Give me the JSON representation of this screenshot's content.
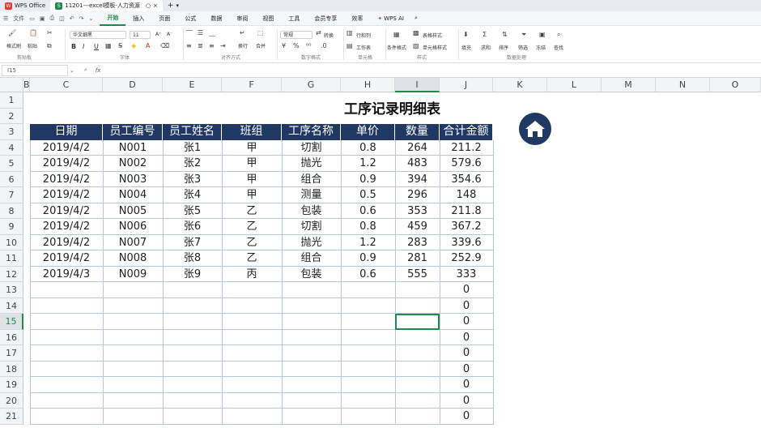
{
  "titlebar": {
    "app_tab": "WPS Office",
    "doc_tab": "11201---excel模板-人力资源",
    "add_tab": "+",
    "dropdown": "▾"
  },
  "menubar": {
    "file": "文件",
    "items": [
      "开始",
      "插入",
      "页面",
      "公式",
      "数据",
      "审阅",
      "视图",
      "工具",
      "会员专享",
      "效率"
    ],
    "active_index": 0,
    "ai": "WPS AI",
    "search_icon": "search-icon"
  },
  "ribbon": {
    "clipboard": {
      "label": "剪贴板",
      "paint": "格式刷",
      "paste": "粘贴",
      "cut_icon": "scissors-icon",
      "copy_icon": "copy-icon"
    },
    "font": {
      "label": "字体",
      "name": "华文细黑",
      "size": "11",
      "bold": "B",
      "italic": "I",
      "underline": "U",
      "grow": "A⁺",
      "shrink": "A⁻"
    },
    "align": {
      "label": "对齐方式",
      "wrap": "换行",
      "merge": "合并"
    },
    "number": {
      "label": "数字格式",
      "format": "常规",
      "convert": "转换"
    },
    "cells": {
      "label": "单元格",
      "rowcol": "行和列",
      "sheet": "工作表"
    },
    "style": {
      "label": "样式",
      "cond": "条件格式",
      "table": "表格样式",
      "cellstyle": "单元格样式"
    },
    "data": {
      "label": "数据处理",
      "fill": "填充",
      "sum": "求和",
      "sort": "排序",
      "filter": "筛选",
      "freeze": "冻结",
      "find": "查找"
    }
  },
  "formulabar": {
    "namebox": "I15",
    "fx": "fx"
  },
  "columns": [
    "B",
    "C",
    "D",
    "E",
    "F",
    "G",
    "H",
    "I",
    "J",
    "K",
    "L",
    "M",
    "N",
    "O"
  ],
  "selected_column": "I",
  "rows": [
    "1",
    "2",
    "3",
    "4",
    "5",
    "6",
    "7",
    "8",
    "9",
    "10",
    "11",
    "12",
    "13",
    "14",
    "15",
    "16",
    "17",
    "18",
    "19",
    "20",
    "21"
  ],
  "selected_row": "15",
  "sheet": {
    "title": "工序记录明细表",
    "headers": [
      "日期",
      "员工编号",
      "员工姓名",
      "班组",
      "工序名称",
      "单价",
      "数量",
      "合计金额"
    ],
    "records": [
      [
        "2019/4/2",
        "N001",
        "张1",
        "甲",
        "切割",
        "0.8",
        "264",
        "211.2"
      ],
      [
        "2019/4/2",
        "N002",
        "张2",
        "甲",
        "抛光",
        "1.2",
        "483",
        "579.6"
      ],
      [
        "2019/4/2",
        "N003",
        "张3",
        "甲",
        "组合",
        "0.9",
        "394",
        "354.6"
      ],
      [
        "2019/4/2",
        "N004",
        "张4",
        "甲",
        "测量",
        "0.5",
        "296",
        "148"
      ],
      [
        "2019/4/2",
        "N005",
        "张5",
        "乙",
        "包装",
        "0.6",
        "353",
        "211.8"
      ],
      [
        "2019/4/2",
        "N006",
        "张6",
        "乙",
        "切割",
        "0.8",
        "459",
        "367.2"
      ],
      [
        "2019/4/2",
        "N007",
        "张7",
        "乙",
        "抛光",
        "1.2",
        "283",
        "339.6"
      ],
      [
        "2019/4/2",
        "N008",
        "张8",
        "乙",
        "组合",
        "0.9",
        "281",
        "252.9"
      ],
      [
        "2019/4/3",
        "N009",
        "张9",
        "丙",
        "包装",
        "0.6",
        "555",
        "333"
      ],
      [
        "",
        "",
        "",
        "",
        "",
        "",
        "",
        "0"
      ],
      [
        "",
        "",
        "",
        "",
        "",
        "",
        "",
        "0"
      ],
      [
        "",
        "",
        "",
        "",
        "",
        "",
        "",
        "0"
      ],
      [
        "",
        "",
        "",
        "",
        "",
        "",
        "",
        "0"
      ],
      [
        "",
        "",
        "",
        "",
        "",
        "",
        "",
        "0"
      ],
      [
        "",
        "",
        "",
        "",
        "",
        "",
        "",
        "0"
      ],
      [
        "",
        "",
        "",
        "",
        "",
        "",
        "",
        "0"
      ],
      [
        "",
        "",
        "",
        "",
        "",
        "",
        "",
        "0"
      ],
      [
        "",
        "",
        "",
        "",
        "",
        "",
        "",
        "0"
      ]
    ]
  },
  "home_button_icon": "home-icon",
  "colors": {
    "header_bg": "#1f3864",
    "accent": "#1e8b4a",
    "grid_line": "#b8c7dc"
  }
}
